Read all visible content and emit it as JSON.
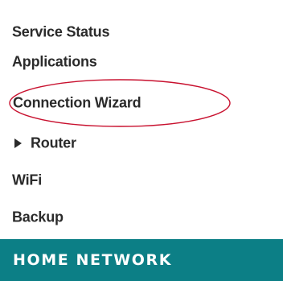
{
  "menu": {
    "items": [
      {
        "label": "Service Status"
      },
      {
        "label": "Applications"
      },
      {
        "label": "Connection Wizard"
      },
      {
        "label": "Router",
        "icon": "triangle-right-icon"
      },
      {
        "label": "WiFi"
      },
      {
        "label": "Backup"
      }
    ]
  },
  "section_header": {
    "title": "HOME NETWORK"
  },
  "colors": {
    "text": "#2b2b2b",
    "header_bg": "#0c7f86",
    "header_text": "#ffffff",
    "annotation": "#c8102e"
  }
}
